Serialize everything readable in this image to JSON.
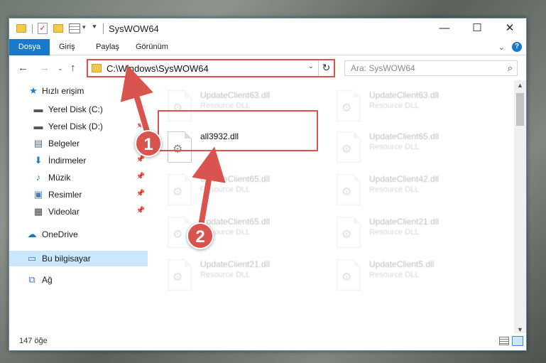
{
  "window": {
    "title": "SysWOW64"
  },
  "ribbon": {
    "tabs": [
      "Dosya",
      "Giriş",
      "Paylaş",
      "Görünüm"
    ],
    "help": "?"
  },
  "nav": {
    "address": "C:\\Windows\\SysWOW64",
    "search_placeholder": "Ara: SysWOW64"
  },
  "sidebar": {
    "items": [
      {
        "label": "Hızlı erişim",
        "icon": "star-icon",
        "level": 0
      },
      {
        "label": "Yerel Disk (C:)",
        "icon": "drive-icon",
        "level": 1,
        "pinned": true
      },
      {
        "label": "Yerel Disk (D:)",
        "icon": "drive-icon",
        "level": 1,
        "pinned": true
      },
      {
        "label": "Belgeler",
        "icon": "documents-icon",
        "level": 1,
        "pinned": true
      },
      {
        "label": "İndirmeler",
        "icon": "download-icon",
        "level": 1,
        "pinned": true
      },
      {
        "label": "Müzik",
        "icon": "music-icon",
        "level": 1,
        "pinned": true
      },
      {
        "label": "Resimler",
        "icon": "pictures-icon",
        "level": 1,
        "pinned": true
      },
      {
        "label": "Videolar",
        "icon": "video-icon",
        "level": 1,
        "pinned": true
      },
      {
        "label": "OneDrive",
        "icon": "cloud-icon",
        "level": 0
      },
      {
        "label": "Bu bilgisayar",
        "icon": "computer-icon",
        "level": 0,
        "selected": true
      },
      {
        "label": "Ağ",
        "icon": "network-icon",
        "level": 0
      }
    ]
  },
  "files": [
    {
      "name": "UpdateClient63.dll",
      "type": "Resource DLL",
      "faded": true
    },
    {
      "name": "UpdateClient63.dll",
      "type": "Resource DLL",
      "faded": true
    },
    {
      "name": "all3932.dll",
      "type": "",
      "faded": false,
      "highlighted": true
    },
    {
      "name": "UpdateClient65.dll",
      "type": "Resource DLL",
      "faded": true
    },
    {
      "name": "UpdateClient65.dll",
      "type": "Resource DLL",
      "faded": true
    },
    {
      "name": "UpdateClient42.dll",
      "type": "Resource DLL",
      "faded": true
    },
    {
      "name": "UpdateClient65.dll",
      "type": "Resource DLL",
      "faded": true
    },
    {
      "name": "UpdateClient21.dll",
      "type": "Resource DLL",
      "faded": true
    },
    {
      "name": "UpdateClient21.dll",
      "type": "Resource DLL",
      "faded": true
    },
    {
      "name": "UpdateClient5.dll",
      "type": "Resource DLL",
      "faded": true
    }
  ],
  "status": {
    "count": "147 öğe"
  },
  "annotations": {
    "step1": "1",
    "step2": "2",
    "color": "#d9534f"
  }
}
